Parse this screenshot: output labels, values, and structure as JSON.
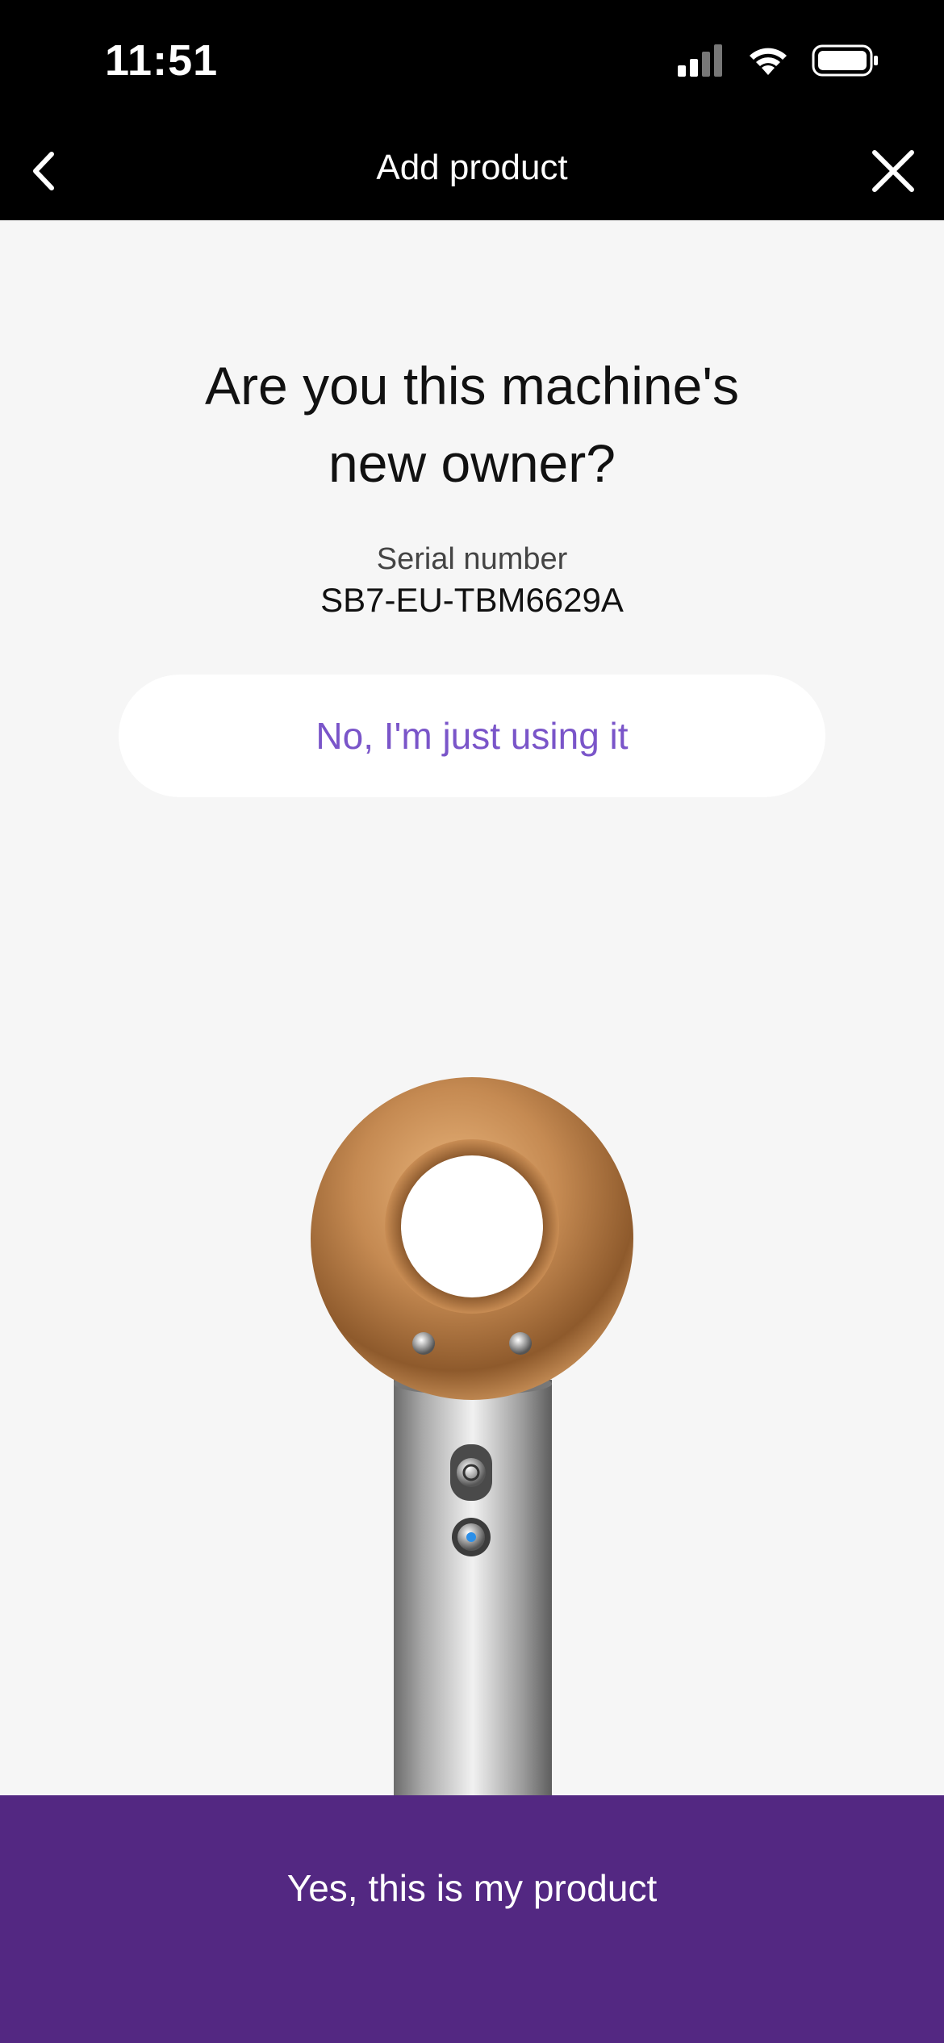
{
  "status_bar": {
    "time": "11:51",
    "icons": [
      "signal-icon",
      "wifi-icon",
      "battery-icon"
    ]
  },
  "nav": {
    "title": "Add product",
    "back_icon": "chevron-left-icon",
    "close_icon": "close-icon"
  },
  "main": {
    "question_line1": "Are you this machine's",
    "question_line2": "new owner?",
    "serial_label": "Serial number",
    "serial_value": "SB7-EU-TBM6629A",
    "secondary_button_label": "No, I'm just using it",
    "product_image": "hair-dryer-image"
  },
  "primary_button_label": "Yes, this is my product",
  "colors": {
    "accent": "#7a55c9",
    "primary_bg": "#532882",
    "header_bg": "#000000",
    "page_bg": "#f6f6f6"
  }
}
